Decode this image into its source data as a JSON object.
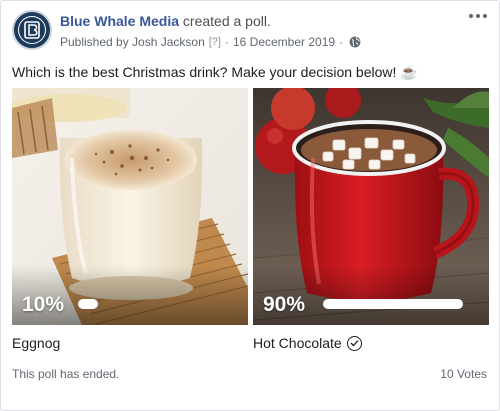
{
  "post": {
    "page_name": "Blue Whale Media",
    "action": "created a poll.",
    "published_by": "Published by Josh Jackson",
    "help_mark": "[?]",
    "separator": "·",
    "date": "16 December 2019",
    "separator2": "·",
    "audience_icon": "globe-icon",
    "question": "Which is the best Christmas drink? Make your decision below! ☕"
  },
  "poll": {
    "options": [
      {
        "label": "Eggnog",
        "percent_text": "10%",
        "percent": 10,
        "winner": false,
        "image": "eggnog-glass-photo"
      },
      {
        "label": "Hot Chocolate",
        "percent_text": "90%",
        "percent": 90,
        "winner": true,
        "image": "hot-chocolate-mug-photo"
      }
    ],
    "status": "This poll has ended.",
    "votes": "10 Votes"
  },
  "colors": {
    "link": "#385898",
    "text": "#1c1e21",
    "muted": "#606770",
    "mug_red": "#c0161c",
    "bar": "#ffffff"
  }
}
